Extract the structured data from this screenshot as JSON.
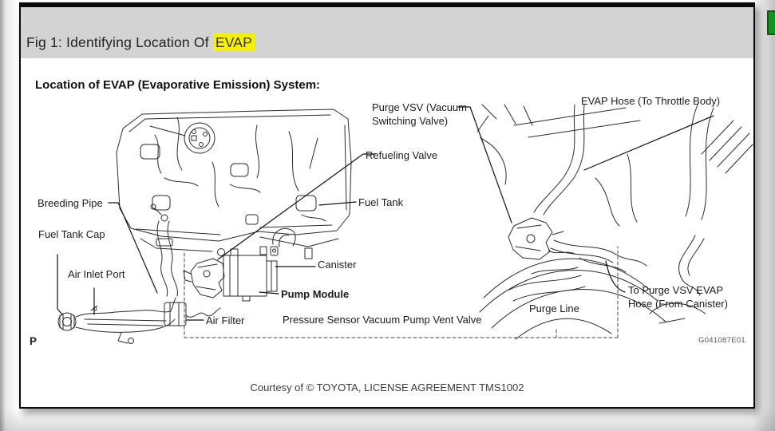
{
  "header": {
    "title_prefix": "Fig 1: Identifying Location Of ",
    "title_highlight": "EVAP"
  },
  "figure": {
    "heading": "Location of EVAP (Evaporative Emission) System:",
    "labels": {
      "purge_vsv": "Purge VSV (Vacuum Switching Valve)",
      "evap_hose": "EVAP Hose (To Throttle Body)",
      "refueling_valve": "Refueling Valve",
      "breeding_pipe": "Breeding Pipe",
      "fuel_tank": "Fuel Tank",
      "fuel_tank_cap": "Fuel Tank Cap",
      "air_inlet_port": "Air Inlet Port",
      "canister": "Canister",
      "pump_module": "Pump Module",
      "air_filter": "Air Filter",
      "pressure_sensor": "Pressure Sensor Vacuum Pump Vent Valve",
      "purge_line": "Purge Line",
      "to_purge_vsv": "To Purge VSV EVAP Hose (From Canister)"
    },
    "drawing_code": "G041087E01",
    "page_marker": "P"
  },
  "footer": {
    "courtesy": "Courtesy of © TOYOTA, LICENSE AGREEMENT TMS1002"
  },
  "colors": {
    "highlight": "#f7f000",
    "header_band": "#d3d3d3",
    "frame_border": "#0a0a0a",
    "green_tab": "#17911c",
    "line_art": "#2b2b2b"
  }
}
